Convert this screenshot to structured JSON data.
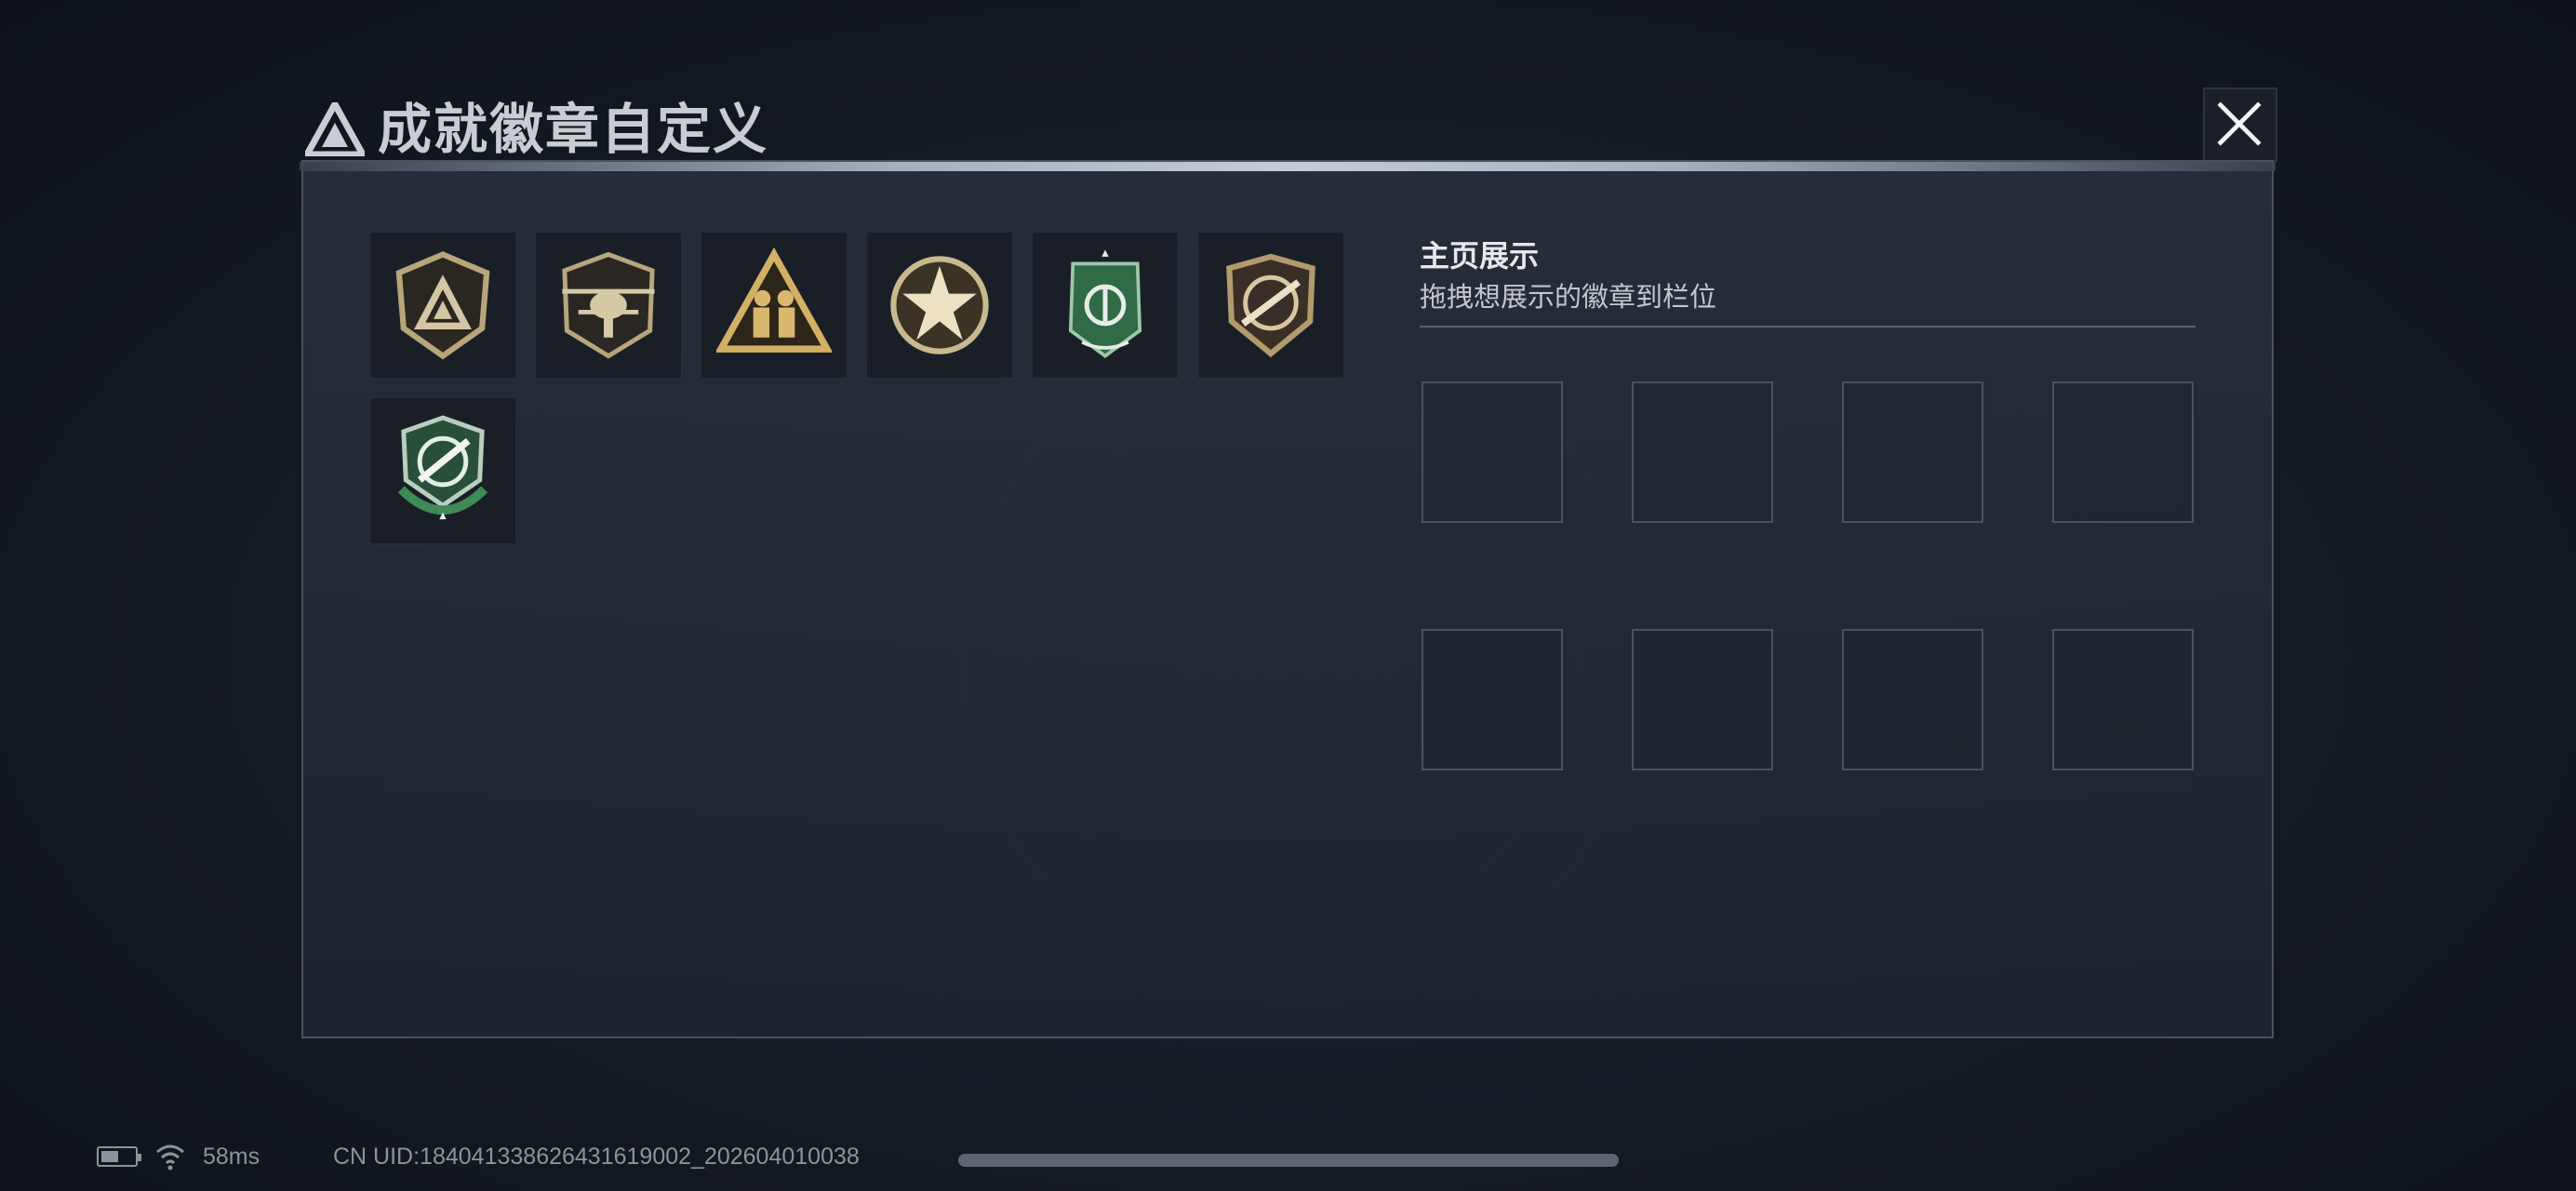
{
  "header": {
    "title": "成就徽章自定义",
    "logo_icon": "triangle-logo-icon",
    "close_icon": "close-icon"
  },
  "badges": [
    {
      "name": "triangle-shield-badge",
      "color": "#b8a57a"
    },
    {
      "name": "helicopter-badge",
      "color": "#b8a57a"
    },
    {
      "name": "soldiers-triangle-badge",
      "color": "#d2b064"
    },
    {
      "name": "star-medal-badge",
      "color": "#c9b98f"
    },
    {
      "name": "green-shield-badge",
      "color": "#3f7a52"
    },
    {
      "name": "rifle-badge",
      "color": "#b29a6c"
    },
    {
      "name": "green-knife-badge",
      "color": "#3f7a52"
    }
  ],
  "display": {
    "title": "主页展示",
    "subtitle": "拖拽想展示的徽章到栏位",
    "slots": 8
  },
  "status": {
    "ping": "58ms",
    "uid": "CN UID:1840413386264316190​02_202604010038"
  }
}
